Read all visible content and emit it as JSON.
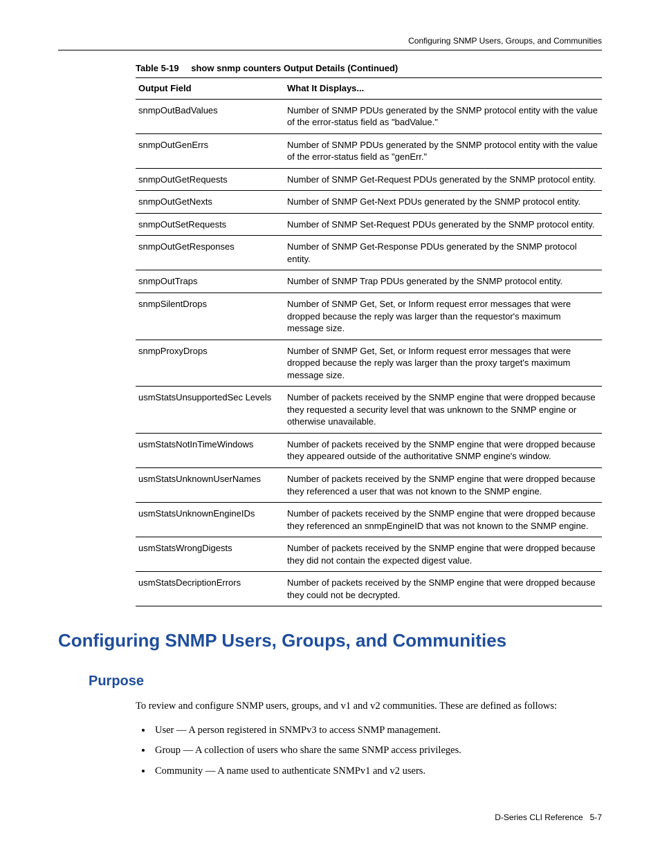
{
  "running_header": "Configuring SNMP Users, Groups, and Communities",
  "table": {
    "caption_num": "Table 5-19",
    "caption_text": "show snmp counters Output Details (Continued)",
    "headers": {
      "col1": "Output Field",
      "col2": "What It Displays..."
    },
    "rows": [
      {
        "field": "snmpOutBadValues",
        "desc": "Number of SNMP PDUs generated by the SNMP protocol entity with the value of the error-status field as \"badValue.\""
      },
      {
        "field": "snmpOutGenErrs",
        "desc": "Number of SNMP PDUs generated by the SNMP protocol entity with the value of the error-status field as \"genErr.\""
      },
      {
        "field": "snmpOutGetRequests",
        "desc": "Number of SNMP Get-Request PDUs generated by the SNMP protocol entity."
      },
      {
        "field": "snmpOutGetNexts",
        "desc": "Number of SNMP Get-Next PDUs generated by the SNMP protocol entity."
      },
      {
        "field": "snmpOutSetRequests",
        "desc": "Number of SNMP Set-Request PDUs generated by the SNMP protocol entity."
      },
      {
        "field": "snmpOutGetResponses",
        "desc": "Number of SNMP Get-Response PDUs generated by the SNMP protocol entity."
      },
      {
        "field": "snmpOutTraps",
        "desc": "Number of SNMP Trap PDUs generated by the SNMP protocol entity."
      },
      {
        "field": "snmpSilentDrops",
        "desc": "Number of SNMP Get, Set, or Inform request error messages that were dropped because the reply was larger than the requestor's maximum message size."
      },
      {
        "field": "snmpProxyDrops",
        "desc": "Number of SNMP Get, Set, or Inform request error messages that were dropped because the reply was larger than the proxy target's maximum message size."
      },
      {
        "field": "usmStatsUnsupportedSec Levels",
        "desc": "Number of packets received by the SNMP engine that were dropped because they requested a security level that was unknown to the SNMP engine or otherwise unavailable."
      },
      {
        "field": "usmStatsNotInTimeWindows",
        "desc": "Number of packets received by the SNMP engine that were dropped because they appeared outside of the authoritative SNMP engine's window."
      },
      {
        "field": "usmStatsUnknownUserNames",
        "desc": "Number of packets received by the SNMP engine that were dropped because they referenced a user that was not known to the SNMP engine."
      },
      {
        "field": "usmStatsUnknownEngineIDs",
        "desc": "Number of packets received by the SNMP engine that were dropped because they referenced an snmpEngineID that was not known to the SNMP engine."
      },
      {
        "field": "usmStatsWrongDigests",
        "desc": "Number of packets received by the SNMP engine that were dropped because they did not contain the expected digest value."
      },
      {
        "field": "usmStatsDecriptionErrors",
        "desc": "Number of packets received by the SNMP engine that were dropped because they could not be decrypted."
      }
    ]
  },
  "section": {
    "h1": "Configuring SNMP Users, Groups, and Communities",
    "h2": "Purpose",
    "intro": "To review and configure SNMP users, groups, and v1 and v2 communities. These are defined as follows:",
    "bullets": [
      "User — A person registered in SNMPv3 to access SNMP management.",
      "Group — A collection of users who share the same SNMP access privileges.",
      "Community — A name used to authenticate SNMPv1 and v2 users."
    ]
  },
  "footer": {
    "left": "D-Series CLI Reference",
    "right": "5-7"
  }
}
